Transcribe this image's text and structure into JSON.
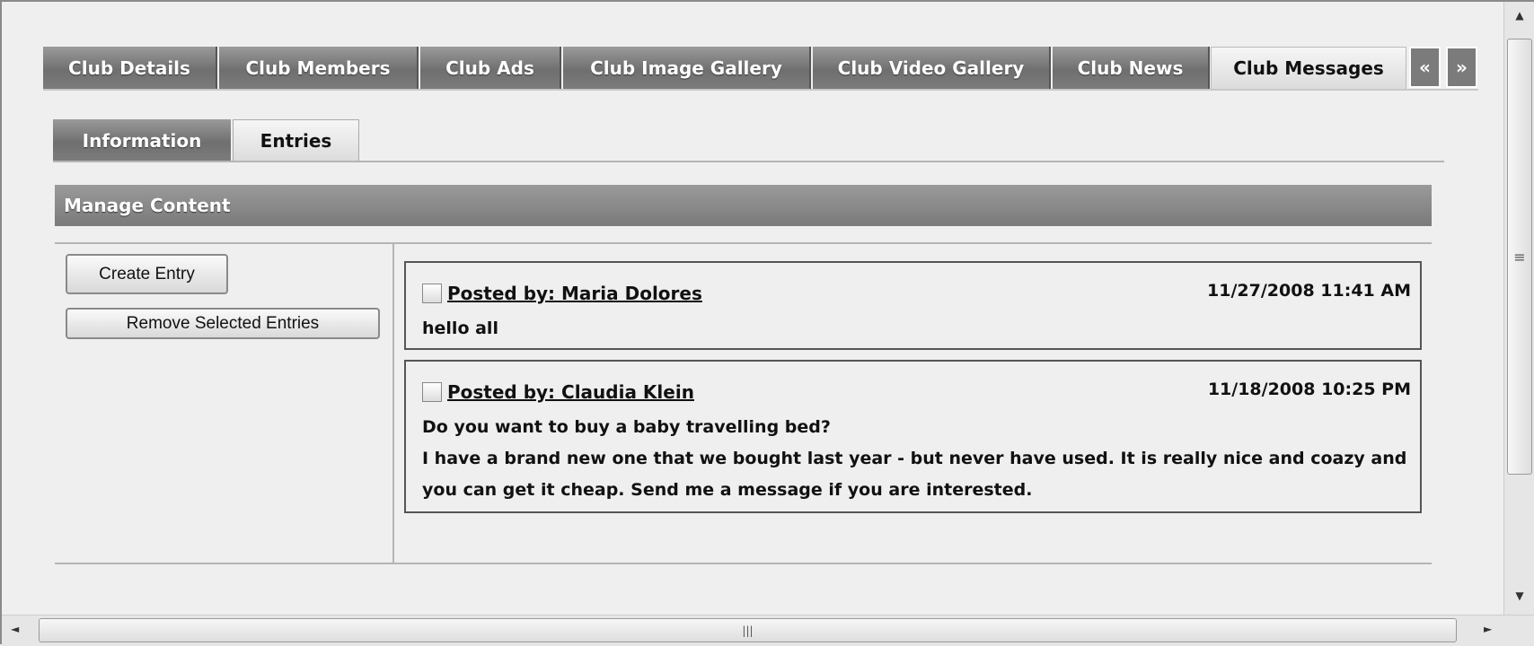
{
  "tabs": [
    {
      "label": "Club Details"
    },
    {
      "label": "Club Members"
    },
    {
      "label": "Club Ads"
    },
    {
      "label": "Club Image Gallery"
    },
    {
      "label": "Club Video Gallery"
    },
    {
      "label": "Club News"
    },
    {
      "label": "Club Messages",
      "active": true
    }
  ],
  "tab_nav": {
    "prev": "«",
    "next": "»"
  },
  "subtabs": [
    {
      "label": "Information"
    },
    {
      "label": "Entries",
      "active": true
    }
  ],
  "section_title": "Manage Content",
  "actions": {
    "create": "Create Entry",
    "remove": "Remove Selected Entries"
  },
  "entries": [
    {
      "author": "Posted by: Maria Dolores",
      "date": "11/27/2008 11:41 AM",
      "lines": [
        "hello all"
      ]
    },
    {
      "author": "Posted by: Claudia Klein",
      "date": "11/18/2008 10:25 PM",
      "lines": [
        "Do you want to buy a baby travelling bed?",
        "I have a brand new one that we bought last year - but never have used. It is really nice and coazy and you can get it cheap. Send me a message if you are interested."
      ]
    }
  ],
  "scrollbar": {
    "up": "▲",
    "down": "▼",
    "left": "◄",
    "right": "►",
    "grip": "≡",
    "hgrip": "|||"
  }
}
